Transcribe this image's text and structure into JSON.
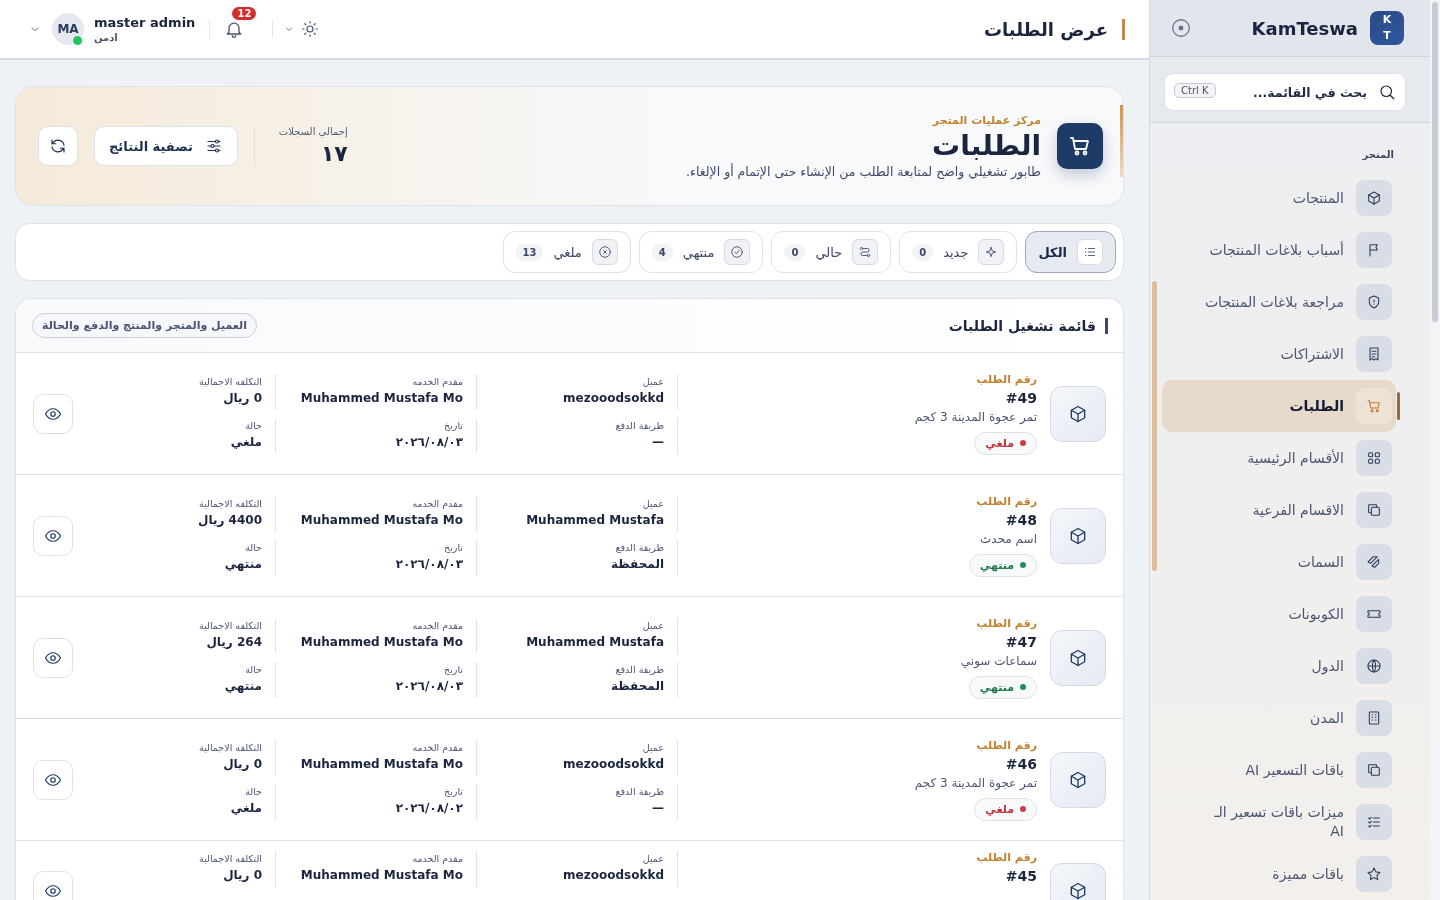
{
  "topbar": {
    "title": "عرض الطلبات",
    "user": {
      "initials": "MA",
      "name": "master admin",
      "role": "ادمن",
      "online": true
    },
    "notifications": "12"
  },
  "sidebar": {
    "brand": {
      "logo_top": "K",
      "logo_bottom": "T",
      "name": "KamTeswa"
    },
    "search": {
      "placeholder": "بحث في القائمة...",
      "shortcut": "Ctrl K"
    },
    "section": "المتجر",
    "items": [
      {
        "label": "المنتجات",
        "selected": false
      },
      {
        "label": "أسباب بلاغات المنتجات",
        "selected": false
      },
      {
        "label": "مراجعة بلاغات المنتجات",
        "selected": false
      },
      {
        "label": "الاشتراكات",
        "selected": false
      },
      {
        "label": "الطلبات",
        "selected": true
      },
      {
        "label": "الأقسام الرئيسية",
        "selected": false
      },
      {
        "label": "الاقسام الفرعية",
        "selected": false
      },
      {
        "label": "السمات",
        "selected": false
      },
      {
        "label": "الكوبونات",
        "selected": false
      },
      {
        "label": "الدول",
        "selected": false
      },
      {
        "label": "المدن",
        "selected": false
      },
      {
        "label": "باقات التسعير AI",
        "selected": false
      },
      {
        "label": "ميزات باقات تسعير الـ AI",
        "selected": false
      },
      {
        "label": "باقات مميزة",
        "selected": false
      }
    ]
  },
  "hero": {
    "eyebrow": "مركز عمليات المتجر",
    "title": "الطلبات",
    "description": "طابور تشغيلي واضح لمتابعة الطلب من الإنشاء حتى الإتمام أو الإلغاء.",
    "total_label": "إجمالي السجلات",
    "total": "١٧",
    "filter_button": "تصفية النتائج"
  },
  "tabs": [
    {
      "label": "الكل",
      "selected": true
    },
    {
      "label": "جديد",
      "count": "0",
      "selected": false
    },
    {
      "label": "حالي",
      "count": "0",
      "selected": false
    },
    {
      "label": "منتهي",
      "count": "4",
      "selected": false
    },
    {
      "label": "ملغي",
      "count": "13",
      "selected": false
    }
  ],
  "list": {
    "title": "قائمة تشغيل الطلبات",
    "hint": "العميل والمتجر والمنتج والدفع والحالة",
    "orders": [
      {
        "number_label": "رقم الطلب",
        "number": "#49",
        "product": "تمر عجوة المدينة 3 كجم",
        "status": {
          "label": "ملغي",
          "kind": "cancelled"
        },
        "fields": [
          {
            "label": "عميل",
            "value": "mezooodsokkd"
          },
          {
            "label": "مقدم الخدمه",
            "value": "Muhammed Mustafa Mo"
          },
          {
            "label": "التكلفه الاجمالية",
            "value": "0 ريال"
          },
          {
            "label": "طريقة الدفع",
            "value": "—"
          },
          {
            "label": "تاريخ",
            "value": "٢٠٢٦/٠٨/٠٣"
          },
          {
            "label": "حالة",
            "value": "ملغي"
          }
        ]
      },
      {
        "number_label": "رقم الطلب",
        "number": "#48",
        "product": "اسم محدث",
        "status": {
          "label": "منتهي",
          "kind": "done"
        },
        "fields": [
          {
            "label": "عميل",
            "value": "Muhammed Mustafa"
          },
          {
            "label": "مقدم الخدمه",
            "value": "Muhammed Mustafa Mo"
          },
          {
            "label": "التكلفه الاجمالية",
            "value": "4400 ريال"
          },
          {
            "label": "طريقة الدفع",
            "value": "المحفظة"
          },
          {
            "label": "تاريخ",
            "value": "٢٠٢٦/٠٨/٠٣"
          },
          {
            "label": "حالة",
            "value": "منتهي"
          }
        ]
      },
      {
        "number_label": "رقم الطلب",
        "number": "#47",
        "product": "سماعات سوني",
        "status": {
          "label": "منتهي",
          "kind": "done"
        },
        "fields": [
          {
            "label": "عميل",
            "value": "Muhammed Mustafa"
          },
          {
            "label": "مقدم الخدمه",
            "value": "Muhammed Mustafa Mo"
          },
          {
            "label": "التكلفه الاجمالية",
            "value": "264 ريال"
          },
          {
            "label": "طريقة الدفع",
            "value": "المحفظة"
          },
          {
            "label": "تاريخ",
            "value": "٢٠٢٦/٠٨/٠٣"
          },
          {
            "label": "حالة",
            "value": "منتهي"
          }
        ]
      },
      {
        "number_label": "رقم الطلب",
        "number": "#46",
        "product": "تمر عجوة المدينة 3 كجم",
        "status": {
          "label": "ملغي",
          "kind": "cancelled"
        },
        "fields": [
          {
            "label": "عميل",
            "value": "mezooodsokkd"
          },
          {
            "label": "مقدم الخدمه",
            "value": "Muhammed Mustafa Mo"
          },
          {
            "label": "التكلفه الاجمالية",
            "value": "0 ريال"
          },
          {
            "label": "طريقة الدفع",
            "value": "—"
          },
          {
            "label": "تاريخ",
            "value": "٢٠٢٦/٠٨/٠٢"
          },
          {
            "label": "حالة",
            "value": "ملغي"
          }
        ]
      },
      {
        "number_label": "رقم الطلب",
        "number": "#45",
        "fields": [
          {
            "label": "عميل",
            "value": "mezooodsokkd"
          },
          {
            "label": "مقدم الخدمه",
            "value": "Muhammed Mustafa Mo"
          },
          {
            "label": "التكلفه الاجمالية",
            "value": "0 ريال"
          }
        ]
      }
    ]
  }
}
